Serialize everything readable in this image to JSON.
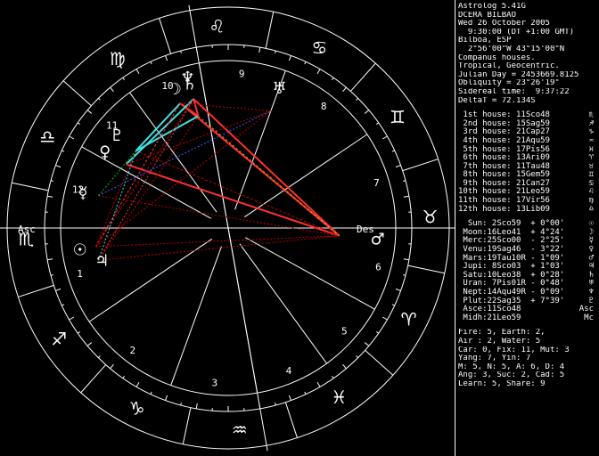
{
  "app": {
    "title": "Astrolog 5.41G"
  },
  "chart_info": [
    "Astrolog 5.41G",
    "DCERA BILBAO",
    "Wed 26 October 2005",
    "  9:30:00 (DT +1:00 GMT)",
    "Bilboa, ESP",
    "  2°56'00\"W 43°15'00\"N",
    "Companus houses.",
    "Tropical, Geocentric.",
    "Julian Day = 2453669.8125",
    "Obliquity = 23°26'19\"",
    "Sidereal time:  9:37:22",
    "DeltaT = 72.134S"
  ],
  "houses": [
    {
      "label": " 1st house:",
      "value": "11Sco48",
      "glyph": "♏"
    },
    {
      "label": " 2nd house:",
      "value": "15Sag59",
      "glyph": "♐"
    },
    {
      "label": " 3rd house:",
      "value": "21Cap27",
      "glyph": "♑"
    },
    {
      "label": " 4th house:",
      "value": "21Aqu59",
      "glyph": "♒"
    },
    {
      "label": " 5th house:",
      "value": "17Pis56",
      "glyph": "♓"
    },
    {
      "label": " 6th house:",
      "value": "13Ari09",
      "glyph": "♈"
    },
    {
      "label": " 7th house:",
      "value": "11Tau48",
      "glyph": "♉"
    },
    {
      "label": " 8th house:",
      "value": "15Gem59",
      "glyph": "♊"
    },
    {
      "label": " 9th house:",
      "value": "21Can27",
      "glyph": "♋"
    },
    {
      "label": "10th house:",
      "value": "21Leo59",
      "glyph": "♌"
    },
    {
      "label": "11th house:",
      "value": "17Vir56",
      "glyph": "♍"
    },
    {
      "label": "12th house:",
      "value": "13Lib09",
      "glyph": "♎"
    }
  ],
  "planets": [
    {
      "label": "  Sun:",
      "value": " 2Sco59  + 0°00'",
      "glyph": "☉"
    },
    {
      "label": " Moon:",
      "value": "16Leo41  + 4°24'",
      "glyph": "☽"
    },
    {
      "label": " Merc:",
      "value": "25Sco00  - 2°25'",
      "glyph": "☿"
    },
    {
      "label": " Venu:",
      "value": "19Sag46  - 3°22'",
      "glyph": "♀"
    },
    {
      "label": " Mars:",
      "value": "19Tau10R - 1°09'",
      "glyph": "♂"
    },
    {
      "label": " Jupi:",
      "value": " 8Sco03  + 1°03'",
      "glyph": "♃"
    },
    {
      "label": " Satu:",
      "value": "10Leo38  + 0°28'",
      "glyph": "♄"
    },
    {
      "label": " Uran:",
      "value": " 7Pis01R - 0°48'",
      "glyph": "♅"
    },
    {
      "label": " Nept:",
      "value": "14Aqu49R - 0°09'",
      "glyph": "♆"
    },
    {
      "label": " Plut:",
      "value": "22Sag35  + 7°39'",
      "glyph": "♇"
    },
    {
      "label": " Asce:",
      "value": "11Sco48",
      "glyph": "Asc"
    },
    {
      "label": " Midh:",
      "value": "21Leo59",
      "glyph": "Mc"
    }
  ],
  "stats": [
    "Fire: 5, Earth: 2,",
    "Air : 2, Water: 5",
    "Car: 0, Fix: 11, Mut: 3",
    "Yang: 7, Yin: 7",
    "M: 5, N: 5, A: 6, D: 4",
    "Ang: 3, Suc: 2, Cad: 5",
    "Learn: 5, Share: 9"
  ],
  "wheel": {
    "sign_glyphs": [
      "♏",
      "♐",
      "♑",
      "♒",
      "♓",
      "♈",
      "♉",
      "♊",
      "♋",
      "♌",
      "♍",
      "♎"
    ],
    "house_numbers": [
      "1",
      "2",
      "3",
      "4",
      "5",
      "6",
      "7",
      "8",
      "9",
      "10",
      "11",
      "12"
    ],
    "angle_labels": {
      "asc": "Asc",
      "des": "Des"
    },
    "planet_glyphs": {
      "moon": "☽",
      "saturn": "♄",
      "mars": "♂",
      "sun": "☉",
      "jupiter": "♃",
      "mercury": "☿",
      "venus": "♀",
      "pluto": "♇",
      "neptune": "♆",
      "uranus": "♅"
    },
    "colors": {
      "background": "#000000",
      "lines": "#ffffff",
      "red_aspect": "#ff3030",
      "dark_red_aspect": "#c00000",
      "cyan_aspect": "#40e0e0",
      "yellow_aspect": "#c8c800",
      "green_aspect": "#00c000",
      "blue_aspect": "#4060ff"
    }
  }
}
